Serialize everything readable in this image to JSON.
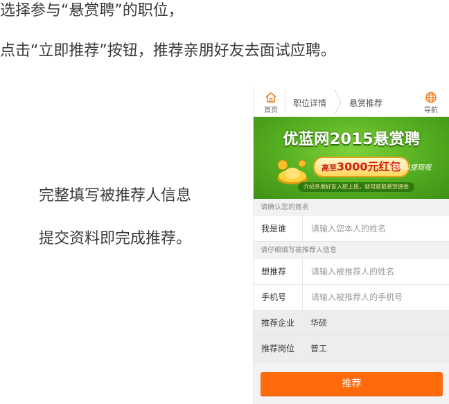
{
  "instructions": {
    "line1": "选择参与“悬赏聘”的职位，",
    "line2": "点击“立即推荐”按钮，推荐亲朋好友去面试应聘。"
  },
  "left_text": {
    "line1": "完整填写被推荐人信息",
    "line2": "提交资料即完成推荐。"
  },
  "phone": {
    "topbar": {
      "home_label": "首页",
      "crumb1": "职位详情",
      "crumb2": "悬赏推荐",
      "nav_label": "导航"
    },
    "banner": {
      "title": "优蓝网2015悬赏聘",
      "pill_prefix": "高至",
      "pill_amount": "3000元红包",
      "tail": "还可以提现哦",
      "strip": "介绍亲朋好友入职上班，就可获取悬赏佣金"
    },
    "section1": "请确认您的姓名",
    "section2": "请仔细填写被推荐人信息",
    "rows": [
      {
        "label": "我是谁",
        "placeholder": "请输入您本人的姓名"
      },
      {
        "label": "想推荐",
        "placeholder": "请输入被推荐人的姓名"
      },
      {
        "label": "手机号",
        "placeholder": "请输入被推荐人的手机号"
      },
      {
        "label": "推荐企业",
        "value": "华硕"
      },
      {
        "label": "推荐岗位",
        "value": "普工"
      }
    ],
    "submit_label": "推荐"
  },
  "colors": {
    "accent_orange": "#ff6a0a",
    "banner_green": "#54ad1f"
  }
}
